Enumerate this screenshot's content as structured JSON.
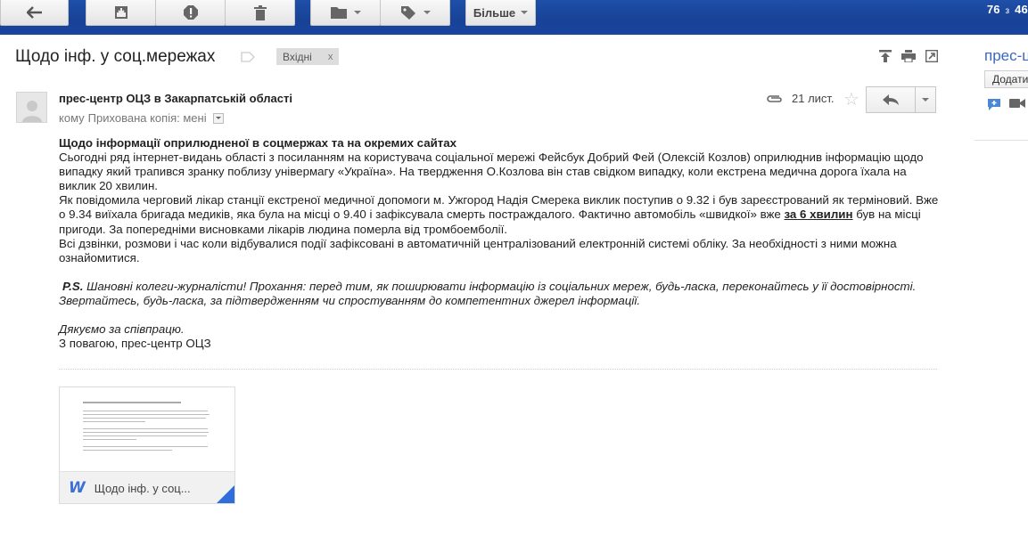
{
  "toolbar": {
    "more_label": "Більше",
    "counter_from": "76",
    "counter_sep": "з",
    "counter_total": "46"
  },
  "thread": {
    "subject": "Щодо інф. у соц.мережах",
    "label_chip": "Вхідні",
    "label_chip_remove": "x"
  },
  "message": {
    "sender": "прес-центр ОЦЗ в Закарпатській області",
    "to_prefix": "кому",
    "to_value": "Прихована копія: мені",
    "date": "21 лист.",
    "body": {
      "title": "Щодо інформації оприлюдненої в соцмержах та на окремих сайтах",
      "p1": "Сьогодні ряд інтернет-видань області з посиланням на користувача соціальної мережі Фейсбук  Добрий Фей (Олексій Козлов) оприлюднив інформацію щодо випадку який трапився зранку поблизу універмагу «Україна». На твердження О.Козлова він став свідком випадку, коли екстрена медична дорога їхала на виклик 20 хвилин.",
      "p2_a": "Як повідомила черговий лікар станції екстреної медичної допомоги м. Ужгород Надія Смерека виклик поступив о 9.32 і був зареєстрований як терміновий. Вже о 9.34 виїхала бригада медиків, яка була на місці о 9.40 і зафіксувала смерть постраждалого. Фактично автомобіль «швидкої» вже ",
      "p2_bold": "за 6 хвилин",
      "p2_b": " був на місці пригоди. За попередніми висновками лікарів людина померла від тромбоемболії.",
      "p3": "Всі дзвінки, розмови і час коли відбувалися події зафіксовані в автоматичній централізований електронній системі обліку. За необхідності з ними можна ознайомитися.",
      "ps_label": "P.S.",
      "ps_text": " Шановні колеги-журналісти! Прохання: перед тим, як поширювати інформацію із соціальних мереж, будь-ласка, переконайтесь у її достовірності. Звертайтесь, будь-ласка, за підтвердженням чи спростуванням до компетентних джерел інформації.",
      "thanks": "Дякуємо за співпрацю.",
      "signature": "З повагою, прес-центр ОЦЗ"
    }
  },
  "attachment": {
    "name": "Щодо інф. у соц...",
    "type_icon": "word-icon"
  },
  "right_panel": {
    "contact_name": "прес-ц",
    "add_button": "Додати"
  },
  "colors": {
    "toolbar_bg": "#1f4fa8",
    "link_blue": "#3a67c4",
    "chip_bg": "#dddddd",
    "word_blue": "#3b6fd6"
  }
}
